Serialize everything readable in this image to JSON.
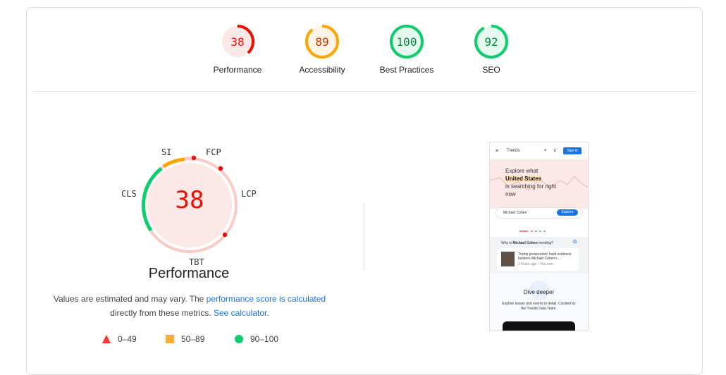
{
  "categories": [
    {
      "label": "Performance",
      "score": "38",
      "value": 0.38,
      "color": "#eb0f00",
      "bg": "#fce8e6",
      "track": "#fcd4d0"
    },
    {
      "label": "Accessibility",
      "score": "89",
      "value": 0.89,
      "color": "#ffa400",
      "bg": "#fff4e3",
      "track": "#ffe6bf"
    },
    {
      "label": "Best Practices",
      "score": "100",
      "value": 1.0,
      "color": "#0cce6b",
      "bg": "#e6f9ef",
      "track": "#c2f0d8"
    },
    {
      "label": "SEO",
      "score": "92",
      "value": 0.92,
      "color": "#0cce6b",
      "bg": "#e6f9ef",
      "track": "#c2f0d8"
    }
  ],
  "performance": {
    "score": "38",
    "title": "Performance",
    "metrics": {
      "si": "SI",
      "fcp": "FCP",
      "lcp": "LCP",
      "tbt": "TBT",
      "cls": "CLS"
    },
    "colors": {
      "fail": "#eb0f00",
      "average": "#ffa400",
      "pass": "#0cce6b"
    }
  },
  "description": {
    "part1": "Values are estimated and may vary. The ",
    "link1": "performance score is calculated",
    "part2": "directly from these metrics. ",
    "link2": "See calculator",
    "part3": "."
  },
  "legend": [
    {
      "label": "0–49",
      "shape": "triangle",
      "color": "#ff3333"
    },
    {
      "label": "50–89",
      "shape": "square",
      "color": "#ffaa33"
    },
    {
      "label": "90–100",
      "shape": "circle",
      "color": "#0cce6b"
    }
  ],
  "screenshot": {
    "app": "Trends",
    "signin": "Sign in",
    "hero_line1": "Explore what",
    "hero_highlight": "United States",
    "hero_line2": "is searching for right",
    "hero_line3": "now",
    "search_value": "Michael Cohen",
    "explore": "Explore",
    "why_prefix": "Why is ",
    "why_term": "Michael Cohen",
    "why_suffix": " trending?",
    "news_line1": "Trump prosecutors' hard evidence",
    "news_line2": "bolsters Michael Cohen's ...",
    "news_meta": "2 hours ago • Yes.com",
    "dive": "Dive deeper",
    "dive_desc1": "Explore issues and events in detail. Curated by",
    "dive_desc2": "the Trends Data Team."
  }
}
